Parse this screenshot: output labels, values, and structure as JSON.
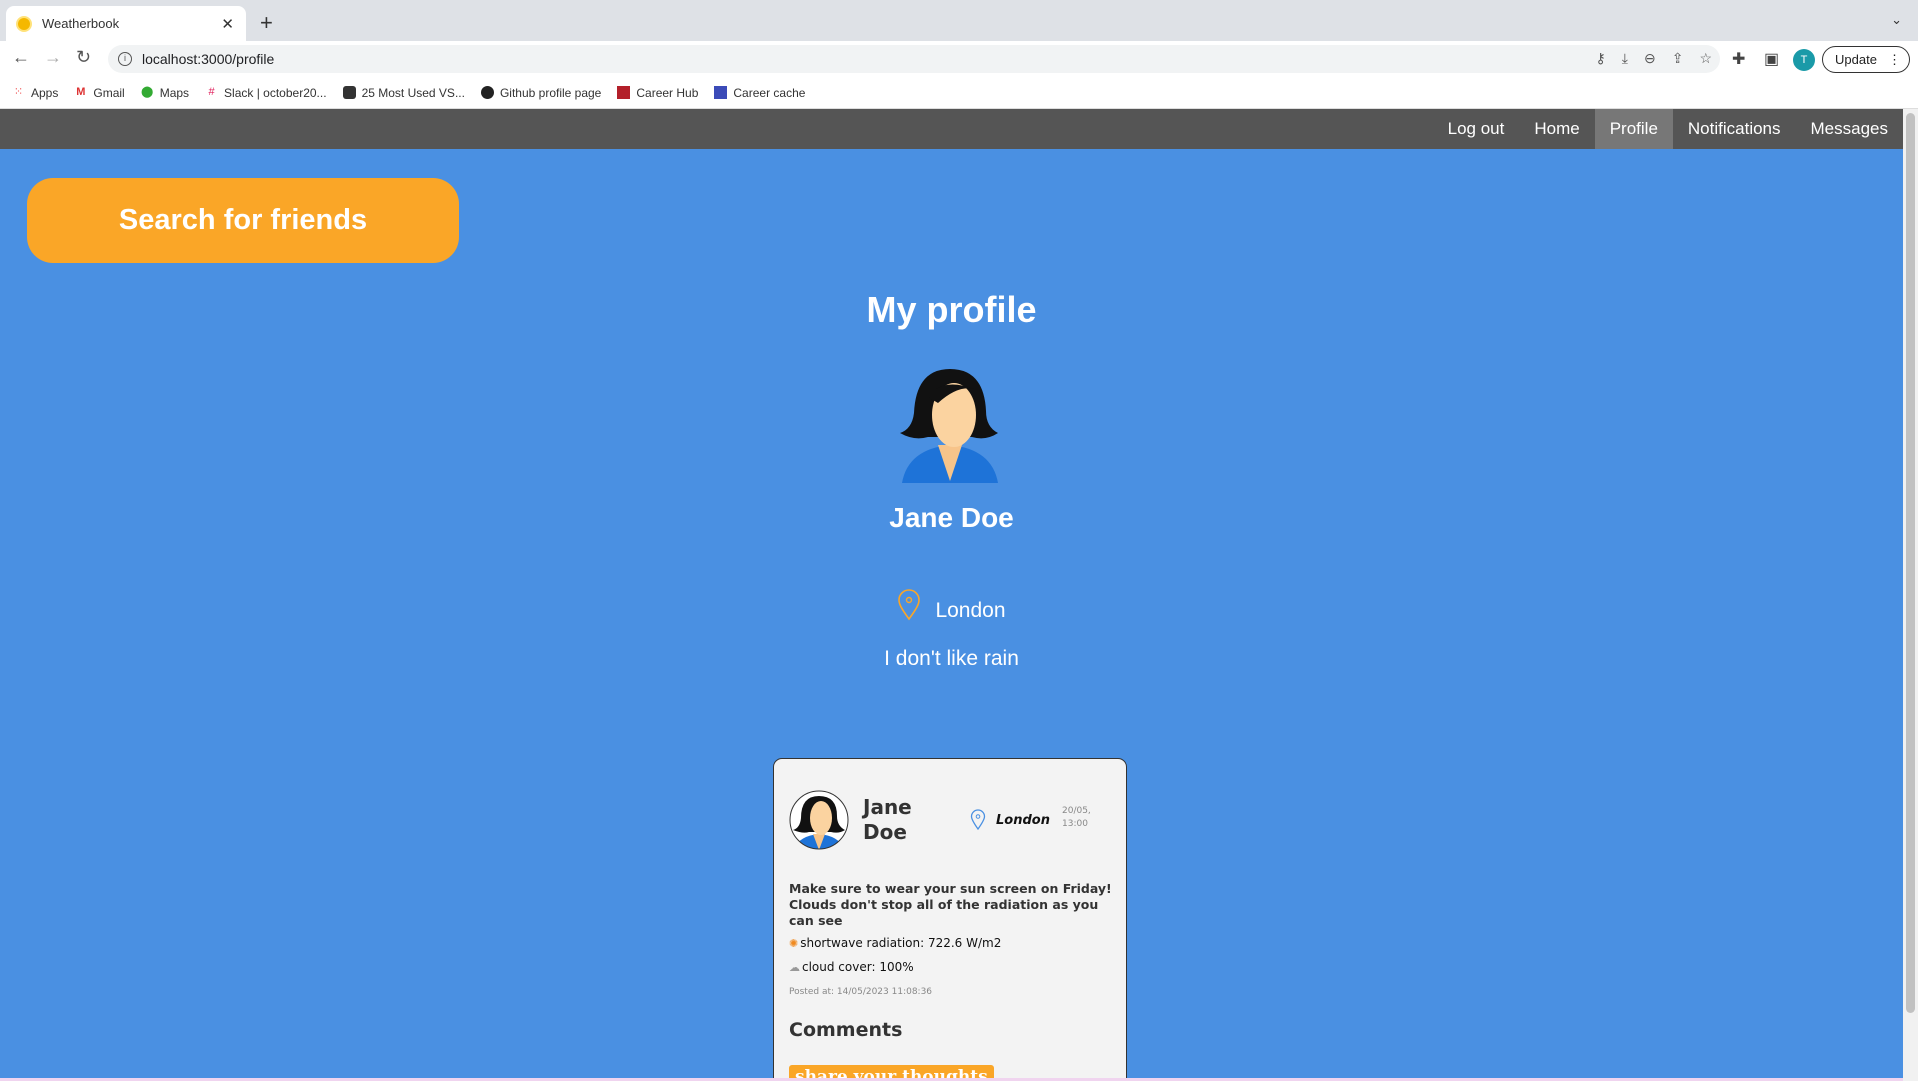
{
  "browser": {
    "tab_title": "Weatherbook",
    "url": "localhost:3000/profile",
    "profile_initial": "T",
    "update_label": "Update",
    "bookmarks": [
      "Apps",
      "Gmail",
      "Maps",
      "Slack | october20...",
      "25 Most Used VS...",
      "Github profile page",
      "Career Hub",
      "Career cache"
    ]
  },
  "nav": {
    "items": [
      "Log out",
      "Home",
      "Profile",
      "Notifications",
      "Messages"
    ],
    "active": "Profile"
  },
  "search_button": "Search for friends",
  "profile": {
    "title": "My profile",
    "name": "Jane Doe",
    "location": "London",
    "bio": "I don't like rain"
  },
  "post": {
    "author": "Jane Doe",
    "location": "London",
    "forecast_date": "20/05,",
    "forecast_time": "13:00",
    "message": "Make sure to wear your sun screen on Friday! Clouds don't stop all of the radiation as you can see",
    "radiation": "shortwave radiation: 722.6 W/m2",
    "cloud": "cloud cover: 100%",
    "posted_at": "Posted at: 14/05/2023 11:08:36",
    "comments_heading": "Comments",
    "share_label": "share your thoughts"
  },
  "colors": {
    "page_bg": "#4a90e2",
    "accent": "#faa627",
    "nav_bg": "#555555"
  }
}
